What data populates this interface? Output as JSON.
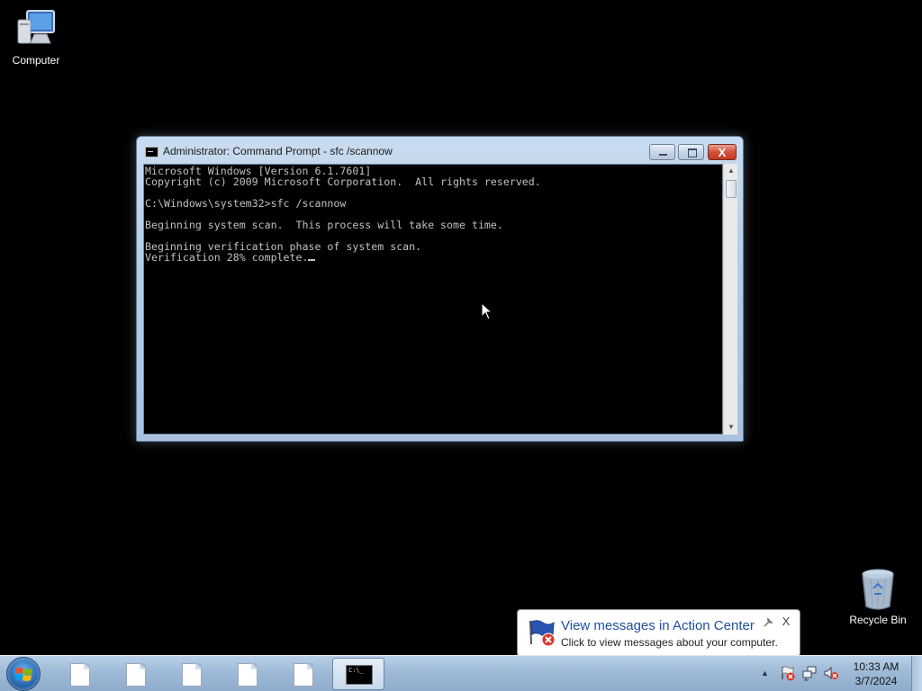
{
  "desktop": {
    "icons": [
      {
        "label": "Computer",
        "icon": "computer-icon"
      },
      {
        "label": "Recycle Bin",
        "icon": "recycle-bin-icon"
      }
    ]
  },
  "window": {
    "title": "Administrator: Command Prompt - sfc  /scannow",
    "icon": "command-prompt-icon",
    "controls": {
      "minimize": "minimize",
      "maximize": "maximize",
      "close": "X"
    },
    "console_lines": [
      "Microsoft Windows [Version 6.1.7601]",
      "Copyright (c) 2009 Microsoft Corporation.  All rights reserved.",
      "",
      "C:\\Windows\\system32>sfc /scannow",
      "",
      "Beginning system scan.  This process will take some time.",
      "",
      "Beginning verification phase of system scan.",
      "Verification 28% complete."
    ],
    "scroll": {
      "up": "▲",
      "down": "▼"
    }
  },
  "notification": {
    "title": "View messages in Action Center",
    "text": "Click to view messages about your computer.",
    "icon": "action-center-flag-icon",
    "close": "X"
  },
  "taskbar": {
    "start_icon": "windows-logo-icon",
    "buttons": [
      {
        "icon": "document-icon"
      },
      {
        "icon": "document-icon"
      },
      {
        "icon": "document-icon"
      },
      {
        "icon": "document-icon"
      },
      {
        "icon": "document-icon"
      },
      {
        "icon": "command-prompt-icon",
        "label": "C:\\_",
        "active": true
      }
    ],
    "tray": {
      "arrow": "▲",
      "icons": [
        "action-center-error-icon",
        "network-icon",
        "volume-muted-icon"
      ],
      "time": "10:33 AM",
      "date": "3/7/2024"
    }
  },
  "colors": {
    "desktop_bg": "#000000",
    "console_text": "#c0c0c0",
    "balloon_title": "#1f4fa0",
    "close_button": "#c23a22"
  }
}
